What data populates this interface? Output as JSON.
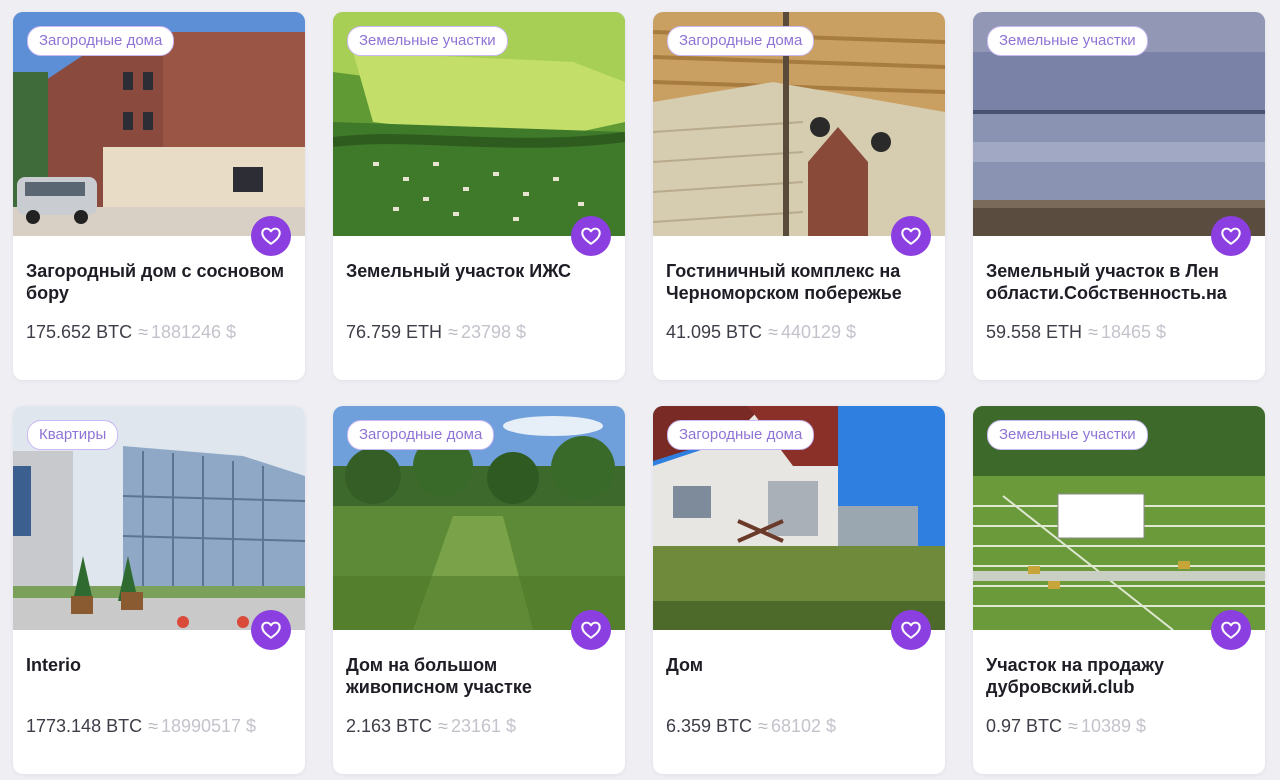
{
  "colors": {
    "accent": "#8b3fe0",
    "badge_text": "#8f74d6",
    "badge_border": "#c9b8f2",
    "page_bg": "#eeeef3"
  },
  "approx_symbol": "≈",
  "listings": [
    {
      "category": "Загородные дома",
      "title": "Загородный дом с сосновом бору",
      "crypto": "175.652 BTC",
      "usd": "1881246 $",
      "favorite_icon": "heart-icon"
    },
    {
      "category": "Земельные участки",
      "title": "Земельный участок ИЖС",
      "crypto": "76.759 ETH",
      "usd": "23798 $",
      "favorite_icon": "heart-icon"
    },
    {
      "category": "Загородные дома",
      "title": "Гостиничный комплекс на Черноморском побережье",
      "crypto": "41.095 BTC",
      "usd": "440129 $",
      "favorite_icon": "heart-icon"
    },
    {
      "category": "Земельные участки",
      "title": "Земельный участок в Лен области.Собственность.на",
      "crypto": "59.558 ETH",
      "usd": "18465 $",
      "favorite_icon": "heart-icon"
    },
    {
      "category": "Квартиры",
      "title": "Interio",
      "crypto": "1773.148 BTC",
      "usd": "18990517 $",
      "favorite_icon": "heart-icon"
    },
    {
      "category": "Загородные дома",
      "title": "Дом на большом живописном участке",
      "crypto": "2.163 BTC",
      "usd": "23161 $",
      "favorite_icon": "heart-icon"
    },
    {
      "category": "Загородные дома",
      "title": "Дом",
      "crypto": "6.359 BTC",
      "usd": "68102 $",
      "favorite_icon": "heart-icon"
    },
    {
      "category": "Земельные участки",
      "title": "Участок на продажу дубровский.club",
      "crypto": "0.97 BTC",
      "usd": "10389 $",
      "favorite_icon": "heart-icon"
    }
  ]
}
